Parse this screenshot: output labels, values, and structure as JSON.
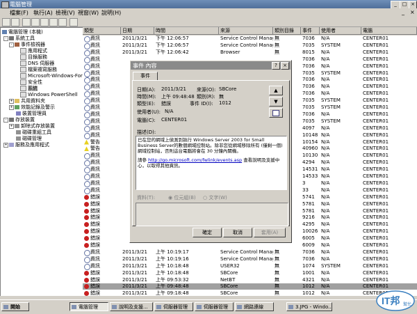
{
  "window": {
    "title": "電腦管理",
    "btn_min": "_",
    "btn_max": "□",
    "btn_close": "×"
  },
  "menu": [
    "檔案(F)",
    "執行(A)",
    "檢視(V)",
    "視窗(W)",
    "說明(H)"
  ],
  "menu_right": {
    "min": "_",
    "close": "×"
  },
  "tree": [
    {
      "label": "電腦管理 (本機)",
      "level": 0
    },
    {
      "label": "系統工具",
      "level": 1
    },
    {
      "label": "事件檢視器",
      "level": 2
    },
    {
      "label": "應用程式",
      "level": 3
    },
    {
      "label": "目錄服務",
      "level": 3
    },
    {
      "label": "DNS 伺服器",
      "level": 3
    },
    {
      "label": "檔案複寫服務",
      "level": 3
    },
    {
      "label": "Microsoft-Windows-Forv",
      "level": 3
    },
    {
      "label": "安全性",
      "level": 3
    },
    {
      "label": "系統",
      "level": 3
    },
    {
      "label": "Windows PowerShell",
      "level": 3
    },
    {
      "label": "共用資料夾",
      "level": 2
    },
    {
      "label": "效能記錄及警示",
      "level": 2
    },
    {
      "label": "裝置管理員",
      "level": 2
    },
    {
      "label": "存放裝置",
      "level": 1
    },
    {
      "label": "卸除式存放裝置",
      "level": 2
    },
    {
      "label": "磁碟重組工具",
      "level": 2
    },
    {
      "label": "磁碟管理",
      "level": 2
    },
    {
      "label": "服務及應用程式",
      "level": 1
    }
  ],
  "columns": [
    "類型",
    "日期",
    "時間",
    "來源",
    "類別目錄",
    "事件",
    "使用者",
    "電腦"
  ],
  "rows": [
    {
      "type": "info",
      "type_label": "資訊",
      "date": "2011/3/21",
      "time": "下午 12:06:57",
      "source": "Service Control Manager",
      "category": "無",
      "event": "7036",
      "user": "N/A",
      "computer": "CENTER01"
    },
    {
      "type": "info",
      "type_label": "資訊",
      "date": "2011/3/21",
      "time": "下午 12:06:57",
      "source": "Service Control Manager",
      "category": "無",
      "event": "7035",
      "user": "SYSTEM",
      "computer": "CENTER01"
    },
    {
      "type": "info",
      "type_label": "資訊",
      "date": "2011/3/21",
      "time": "下午 12:06:42",
      "source": "Browser",
      "category": "無",
      "event": "8015",
      "user": "N/A",
      "computer": "CENTER01"
    },
    {
      "type": "info",
      "type_label": "資訊",
      "date": "",
      "time": "",
      "source": "",
      "category": "",
      "event": "7036",
      "user": "N/A",
      "computer": "CENTER01"
    },
    {
      "type": "info",
      "type_label": "資訊",
      "date": "",
      "time": "",
      "source": "",
      "category": "",
      "event": "7036",
      "user": "N/A",
      "computer": "CENTER01"
    },
    {
      "type": "info",
      "type_label": "資訊",
      "date": "",
      "time": "",
      "source": "",
      "category": "",
      "event": "7035",
      "user": "SYSTEM",
      "computer": "CENTER01"
    },
    {
      "type": "info",
      "type_label": "資訊",
      "date": "",
      "time": "",
      "source": "",
      "category": "",
      "event": "7036",
      "user": "N/A",
      "computer": "CENTER01"
    },
    {
      "type": "info",
      "type_label": "資訊",
      "date": "",
      "time": "",
      "source": "",
      "category": "",
      "event": "7036",
      "user": "N/A",
      "computer": "CENTER01"
    },
    {
      "type": "info",
      "type_label": "資訊",
      "date": "",
      "time": "",
      "source": "",
      "category": "",
      "event": "7036",
      "user": "N/A",
      "computer": "CENTER01"
    },
    {
      "type": "info",
      "type_label": "資訊",
      "date": "",
      "time": "",
      "source": "",
      "category": "",
      "event": "7035",
      "user": "SYSTEM",
      "computer": "CENTER01"
    },
    {
      "type": "info",
      "type_label": "資訊",
      "date": "",
      "time": "",
      "source": "",
      "category": "",
      "event": "7035",
      "user": "SYSTEM",
      "computer": "CENTER01"
    },
    {
      "type": "info",
      "type_label": "資訊",
      "date": "",
      "time": "",
      "source": "",
      "category": "",
      "event": "7036",
      "user": "N/A",
      "computer": "CENTER01"
    },
    {
      "type": "info",
      "type_label": "資訊",
      "date": "",
      "time": "",
      "source": "",
      "category": "",
      "event": "7035",
      "user": "SYSTEM",
      "computer": "CENTER01"
    },
    {
      "type": "info",
      "type_label": "資訊",
      "date": "",
      "time": "",
      "source": "",
      "category": "",
      "event": "4097",
      "user": "N/A",
      "computer": "CENTER01"
    },
    {
      "type": "info",
      "type_label": "資訊",
      "date": "",
      "time": "",
      "source": "",
      "category": "",
      "event": "10148",
      "user": "N/A",
      "computer": "CENTER01"
    },
    {
      "type": "warn",
      "type_label": "警告",
      "date": "",
      "time": "",
      "source": "",
      "category": "",
      "event": "10154",
      "user": "N/A",
      "computer": "CENTER01"
    },
    {
      "type": "warn",
      "type_label": "警告",
      "date": "",
      "time": "",
      "source": "",
      "category": "",
      "event": "40960",
      "user": "N/A",
      "computer": "CENTER01"
    },
    {
      "type": "info",
      "type_label": "資訊",
      "date": "",
      "time": "",
      "source": "",
      "category": "",
      "event": "10130",
      "user": "N/A",
      "computer": "CENTER01"
    },
    {
      "type": "info",
      "type_label": "資訊",
      "date": "",
      "time": "",
      "source": "",
      "category": "",
      "event": "4294",
      "user": "N/A",
      "computer": "CENTER01"
    },
    {
      "type": "info",
      "type_label": "資訊",
      "date": "",
      "time": "",
      "source": "",
      "category": "",
      "event": "14531",
      "user": "N/A",
      "computer": "CENTER01"
    },
    {
      "type": "info",
      "type_label": "資訊",
      "date": "",
      "time": "",
      "source": "",
      "category": "",
      "event": "14533",
      "user": "N/A",
      "computer": "CENTER01"
    },
    {
      "type": "info",
      "type_label": "資訊",
      "date": "",
      "time": "",
      "source": "",
      "category": "",
      "event": "3",
      "user": "N/A",
      "computer": "CENTER01"
    },
    {
      "type": "info",
      "type_label": "資訊",
      "date": "",
      "time": "",
      "source": "",
      "category": "",
      "event": "33",
      "user": "N/A",
      "computer": "CENTER01"
    },
    {
      "type": "err",
      "type_label": "錯誤",
      "date": "",
      "time": "",
      "source": "",
      "category": "",
      "event": "5741",
      "user": "N/A",
      "computer": "CENTER01"
    },
    {
      "type": "err",
      "type_label": "錯誤",
      "date": "",
      "time": "",
      "source": "",
      "category": "",
      "event": "5781",
      "user": "N/A",
      "computer": "CENTER01"
    },
    {
      "type": "err",
      "type_label": "錯誤",
      "date": "",
      "time": "",
      "source": "",
      "category": "",
      "event": "5781",
      "user": "N/A",
      "computer": "CENTER01"
    },
    {
      "type": "err",
      "type_label": "錯誤",
      "date": "",
      "time": "",
      "source": "",
      "category": "",
      "event": "9216",
      "user": "N/A",
      "computer": "CENTER01"
    },
    {
      "type": "err",
      "type_label": "錯誤",
      "date": "",
      "time": "",
      "source": "",
      "category": "",
      "event": "4295",
      "user": "N/A",
      "computer": "CENTER01"
    },
    {
      "type": "err",
      "type_label": "錯誤",
      "date": "",
      "time": "",
      "source": "",
      "category": "",
      "event": "10026",
      "user": "N/A",
      "computer": "CENTER01"
    },
    {
      "type": "err",
      "type_label": "錯誤",
      "date": "",
      "time": "",
      "source": "",
      "category": "",
      "event": "6005",
      "user": "N/A",
      "computer": "CENTER01"
    },
    {
      "type": "err",
      "type_label": "錯誤",
      "date": "",
      "time": "",
      "source": "",
      "category": "",
      "event": "6009",
      "user": "N/A",
      "computer": "CENTER01"
    },
    {
      "type": "info",
      "type_label": "資訊",
      "date": "2011/3/21",
      "time": "上午 10:19:17",
      "source": "Service Control Manager",
      "category": "無",
      "event": "7036",
      "user": "N/A",
      "computer": "CENTER01"
    },
    {
      "type": "info",
      "type_label": "資訊",
      "date": "2011/3/21",
      "time": "上午 10:19:16",
      "source": "Service Control Manager",
      "category": "無",
      "event": "7036",
      "user": "N/A",
      "computer": "CENTER01"
    },
    {
      "type": "info",
      "type_label": "資訊",
      "date": "2011/3/21",
      "time": "上午 10:18:48",
      "source": "USER32",
      "category": "無",
      "event": "1074",
      "user": "SYSTEM",
      "computer": "CENTER01"
    },
    {
      "type": "err",
      "type_label": "錯誤",
      "date": "2011/3/21",
      "time": "上午 10:18:48",
      "source": "SBCore",
      "category": "無",
      "event": "1001",
      "user": "N/A",
      "computer": "CENTER01"
    },
    {
      "type": "err",
      "type_label": "錯誤",
      "date": "2011/3/21",
      "time": "上午 09:53:32",
      "source": "NetBT",
      "category": "無",
      "event": "4321",
      "user": "N/A",
      "computer": "CENTER01"
    },
    {
      "type": "err",
      "type_label": "錯誤",
      "date": "2011/3/21",
      "time": "上午 09:48:48",
      "source": "SBCore",
      "category": "無",
      "event": "1012",
      "user": "N/A",
      "computer": "CENTER01"
    },
    {
      "type": "err",
      "type_label": "錯誤",
      "date": "2011/3/21",
      "time": "上午 09:18:48",
      "source": "SBCore",
      "category": "無",
      "event": "1012",
      "user": "N/A",
      "computer": "CENTER01"
    }
  ],
  "selected_row": 36,
  "dialog": {
    "title": "事件 內容",
    "tab": "事件",
    "date_label": "日期(A):",
    "date": "2011/3/21",
    "source_label": "來源(O):",
    "source": "SBCore",
    "time_label": "時間(M):",
    "time": "上午 09:48:48",
    "category_label": "類別(R):",
    "category": "無",
    "type_label": "類型(E):",
    "type": "錯誤",
    "event_label": "事件 ID(I):",
    "event": "1012",
    "user_label": "使用者(U):",
    "user": "N/A",
    "computer_label": "電腦(C):",
    "computer": "CENTER01",
    "desc_label": "描述(D):",
    "desc_1": "已在您的網域上偵測到執行 Windows Server 2003 for Small Business Server的數個網域控制站。除非您從網域移除所有 (僅剩一個) 網域控制站，否則這台電腦將會在 30 分鐘內關機。",
    "desc_2_prefix": "請參",
    "desc_2_link": "http://go.microsoft.com/fwlink/events.asp",
    "desc_2_suffix": " 查看說明及支援中心，以取得其他資訊。",
    "data_label": "資料(T):",
    "radio_bytes": "位元組(B)",
    "radio_words": "文字(W)",
    "btn_ok": "確定",
    "btn_cancel": "取消",
    "btn_apply": "套用(A)",
    "up_icon": "▲",
    "down_icon": "▼"
  },
  "taskbar": {
    "start": "開始",
    "tasks": [
      "電腦管理",
      "說明及支援...",
      "伺服器管理",
      "伺服器管理",
      "網路連線",
      "3.JPG - Windo..."
    ],
    "clock": "下午 12:08"
  },
  "logo": {
    "text": "IT邦",
    "sub": "幫忙"
  }
}
